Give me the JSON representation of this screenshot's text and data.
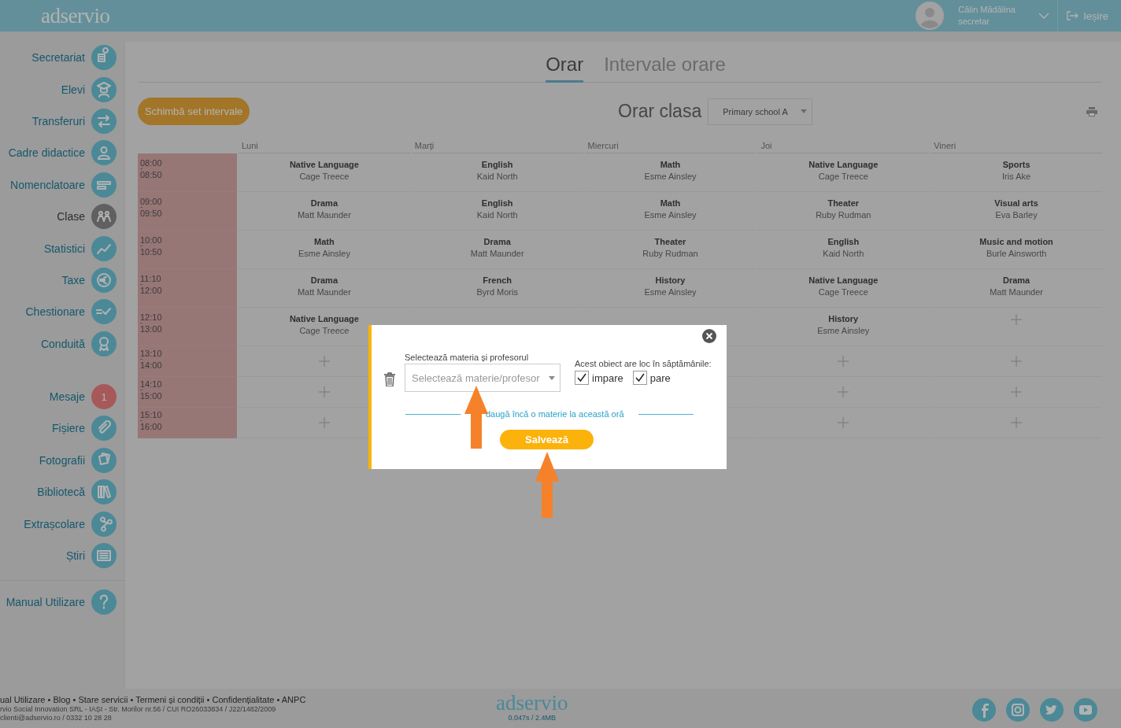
{
  "header": {
    "logo": "adservio",
    "user_name": "Călin Mădălina",
    "user_role": "secretar",
    "logout": "Ieșire"
  },
  "sidebar": {
    "groups": [
      [
        {
          "label": "Secretariat",
          "selected": false
        },
        {
          "label": "Elevi",
          "selected": false
        },
        {
          "label": "Transferuri",
          "selected": false
        },
        {
          "label": "Cadre didactice",
          "selected": false
        },
        {
          "label": "Nomenclatoare",
          "selected": false
        },
        {
          "label": "Clase",
          "selected": true
        },
        {
          "label": "Statistici",
          "selected": false
        },
        {
          "label": "Taxe",
          "selected": false
        },
        {
          "label": "Chestionare",
          "selected": false
        },
        {
          "label": "Conduită",
          "selected": false
        }
      ],
      [
        {
          "label": "Mesaje",
          "selected": false,
          "badge": "1"
        },
        {
          "label": "Fișiere",
          "selected": false
        },
        {
          "label": "Fotografii",
          "selected": false
        },
        {
          "label": "Bibliotecă",
          "selected": false
        },
        {
          "label": "Extrașcolare",
          "selected": false
        },
        {
          "label": "Știri",
          "selected": false
        }
      ],
      [
        {
          "label": "Manual Utilizare",
          "selected": false
        }
      ]
    ]
  },
  "tabs": [
    {
      "label": "Orar",
      "selected": true
    },
    {
      "label": "Intervale orare",
      "selected": false
    }
  ],
  "toolbar": {
    "change_button": "Schimbă set intervale",
    "title": "Orar clasa",
    "class_select": {
      "value": "Primary school A"
    }
  },
  "timetable": {
    "days": [
      "Luni",
      "Marți",
      "Miercuri",
      "Joi",
      "Vineri"
    ],
    "rows": [
      {
        "start": "08:00",
        "dash": "-",
        "end": "08:50",
        "cells": [
          {
            "kind": "lesson",
            "subject": "Native Language",
            "teacher": "Cage Treece"
          },
          {
            "kind": "lesson",
            "subject": "English",
            "teacher": "Kaid North"
          },
          {
            "kind": "lesson",
            "subject": "Math",
            "teacher": "Esme Ainsley"
          },
          {
            "kind": "lesson",
            "subject": "Native Language",
            "teacher": "Cage Treece"
          },
          {
            "kind": "lesson",
            "subject": "Sports",
            "teacher": "Iris Ake"
          }
        ]
      },
      {
        "start": "09:00",
        "dash": "-",
        "end": "09:50",
        "cells": [
          {
            "kind": "lesson",
            "subject": "Drama",
            "teacher": "Matt Maunder"
          },
          {
            "kind": "lesson",
            "subject": "English",
            "teacher": "Kaid North"
          },
          {
            "kind": "lesson",
            "subject": "Math",
            "teacher": "Esme Ainsley"
          },
          {
            "kind": "lesson",
            "subject": "Theater",
            "teacher": "Ruby Rudman"
          },
          {
            "kind": "lesson",
            "subject": "Visual arts",
            "teacher": "Eva Barley"
          }
        ]
      },
      {
        "start": "10:00",
        "dash": "-",
        "end": "10:50",
        "cells": [
          {
            "kind": "lesson",
            "subject": "Math",
            "teacher": "Esme Ainsley"
          },
          {
            "kind": "lesson",
            "subject": "Drama",
            "teacher": "Matt Maunder"
          },
          {
            "kind": "lesson",
            "subject": "Theater",
            "teacher": "Ruby Rudman"
          },
          {
            "kind": "lesson",
            "subject": "English",
            "teacher": "Kaid North"
          },
          {
            "kind": "lesson",
            "subject": "Music and motion",
            "teacher": "Burle Ainsworth"
          }
        ]
      },
      {
        "start": "11:10",
        "dash": "-",
        "end": "12:00",
        "cells": [
          {
            "kind": "lesson",
            "subject": "Drama",
            "teacher": "Matt Maunder"
          },
          {
            "kind": "lesson",
            "subject": "French",
            "teacher": "Byrd Moris"
          },
          {
            "kind": "lesson",
            "subject": "History",
            "teacher": "Esme Ainsley"
          },
          {
            "kind": "lesson",
            "subject": "Native Language",
            "teacher": "Cage Treece"
          },
          {
            "kind": "lesson",
            "subject": "Drama",
            "teacher": "Matt Maunder"
          }
        ]
      },
      {
        "start": "12:10",
        "dash": "-",
        "end": "13:00",
        "cells": [
          {
            "kind": "lesson",
            "subject": "Native Language",
            "teacher": "Cage Treece"
          },
          null,
          null,
          {
            "kind": "lesson",
            "subject": "History",
            "teacher": "Esme Ainsley"
          },
          {
            "kind": "empty"
          }
        ]
      },
      {
        "start": "13:10",
        "dash": "-",
        "end": "14:00",
        "cells": [
          {
            "kind": "empty"
          },
          null,
          null,
          {
            "kind": "empty"
          },
          {
            "kind": "empty"
          }
        ]
      },
      {
        "start": "14:10",
        "dash": "-",
        "end": "15:00",
        "cells": [
          {
            "kind": "empty"
          },
          null,
          null,
          {
            "kind": "empty"
          },
          {
            "kind": "empty"
          }
        ]
      },
      {
        "start": "15:10",
        "dash": "-",
        "end": "16:00",
        "cells": [
          {
            "kind": "empty"
          },
          null,
          null,
          {
            "kind": "empty"
          },
          {
            "kind": "empty"
          }
        ]
      }
    ]
  },
  "modal": {
    "subject_label": "Selectează materia și profesorul",
    "subject_select": {
      "placeholder": "Selectează materie/profesor"
    },
    "weeks_label": "Acest obiect are loc în săptămânile:",
    "weeks": [
      {
        "label": "impare",
        "checked": true
      },
      {
        "label": "pare",
        "checked": true
      }
    ],
    "add_link": "daugă încă o materie la această oră",
    "save_button": "Salvează"
  },
  "footer": {
    "links_line": "ual Utilizare • Blog • Stare servicii • Termeni și condiții • Confidențialitate • ANPC",
    "company_line": "rvio Social Innovation SRL - IAȘI - Str. Morilor nr.56 / CUI RO26033834 / J22/1482/2009",
    "contact_line": "clienti@adservio.ro / 0332 10 28 28",
    "logo": "adservio",
    "stats": "0.047s / 2.4MB"
  }
}
